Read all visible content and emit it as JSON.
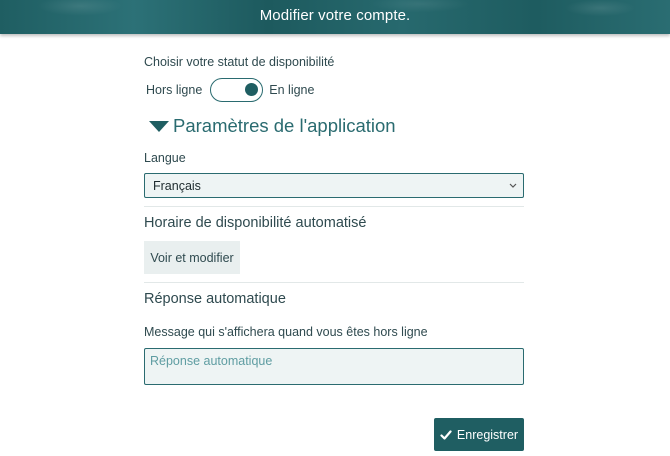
{
  "header": {
    "subtitle": "Modifier votre compte."
  },
  "status": {
    "label": "Choisir votre statut de disponibilité",
    "offline_label": "Hors ligne",
    "online_label": "En ligne",
    "is_online": true
  },
  "app_settings": {
    "title": "Paramètres de l'application",
    "expanded": true,
    "language": {
      "label": "Langue",
      "selected": "Français"
    },
    "schedule": {
      "title": "Horaire de disponibilité automatisé",
      "button_label": "Voir et modifier"
    },
    "auto_reply": {
      "title": "Réponse automatique",
      "message_label": "Message qui s'affichera quand vous êtes hors ligne",
      "placeholder": "Réponse automatique",
      "value": ""
    }
  },
  "actions": {
    "save_label": "Enregistrer",
    "save_icon": "check-icon"
  },
  "colors": {
    "primary": "#1f5e62",
    "field_bg": "#eef4f4"
  }
}
